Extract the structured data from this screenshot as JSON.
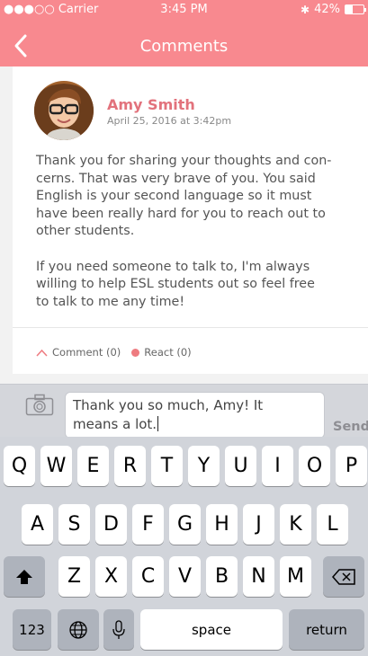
{
  "status_bar": {
    "carrier": "●●●○○ Carrier",
    "time": "3:45 PM",
    "battery_text": "42%",
    "battery_level": 0.42
  },
  "nav": {
    "title": "Comments",
    "back_icon": "chevron-left-icon"
  },
  "comment": {
    "author": "Amy Smith",
    "date": "April 25, 2016 at 3:42pm",
    "text": "Thank you for sharing your thoughts and con-\ncerns. That was very brave of you. You said\nEnglish is your second language so it must\nhave been really hard for you to reach out to\nother students.\n\nIf you need someone to talk to, I'm always\nwilling to help ESL students out so feel free\nto talk to me any time!",
    "comment_action": "Comment (0)",
    "react_action": "React (0)"
  },
  "composer": {
    "value": "Thank you so much, Amy! It\nmeans a lot.",
    "send_label": "Send"
  },
  "keyboard": {
    "row1": [
      "Q",
      "W",
      "E",
      "R",
      "T",
      "Y",
      "U",
      "I",
      "O",
      "P"
    ],
    "row2": [
      "A",
      "S",
      "D",
      "F",
      "G",
      "H",
      "J",
      "K",
      "L"
    ],
    "row3": [
      "Z",
      "X",
      "C",
      "V",
      "B",
      "N",
      "M"
    ],
    "numbers_label": "123",
    "space_label": "space",
    "return_label": "return"
  },
  "colors": {
    "accent": "#f8898f",
    "author": "#e2727c",
    "react_dot": "#ee7b80"
  }
}
